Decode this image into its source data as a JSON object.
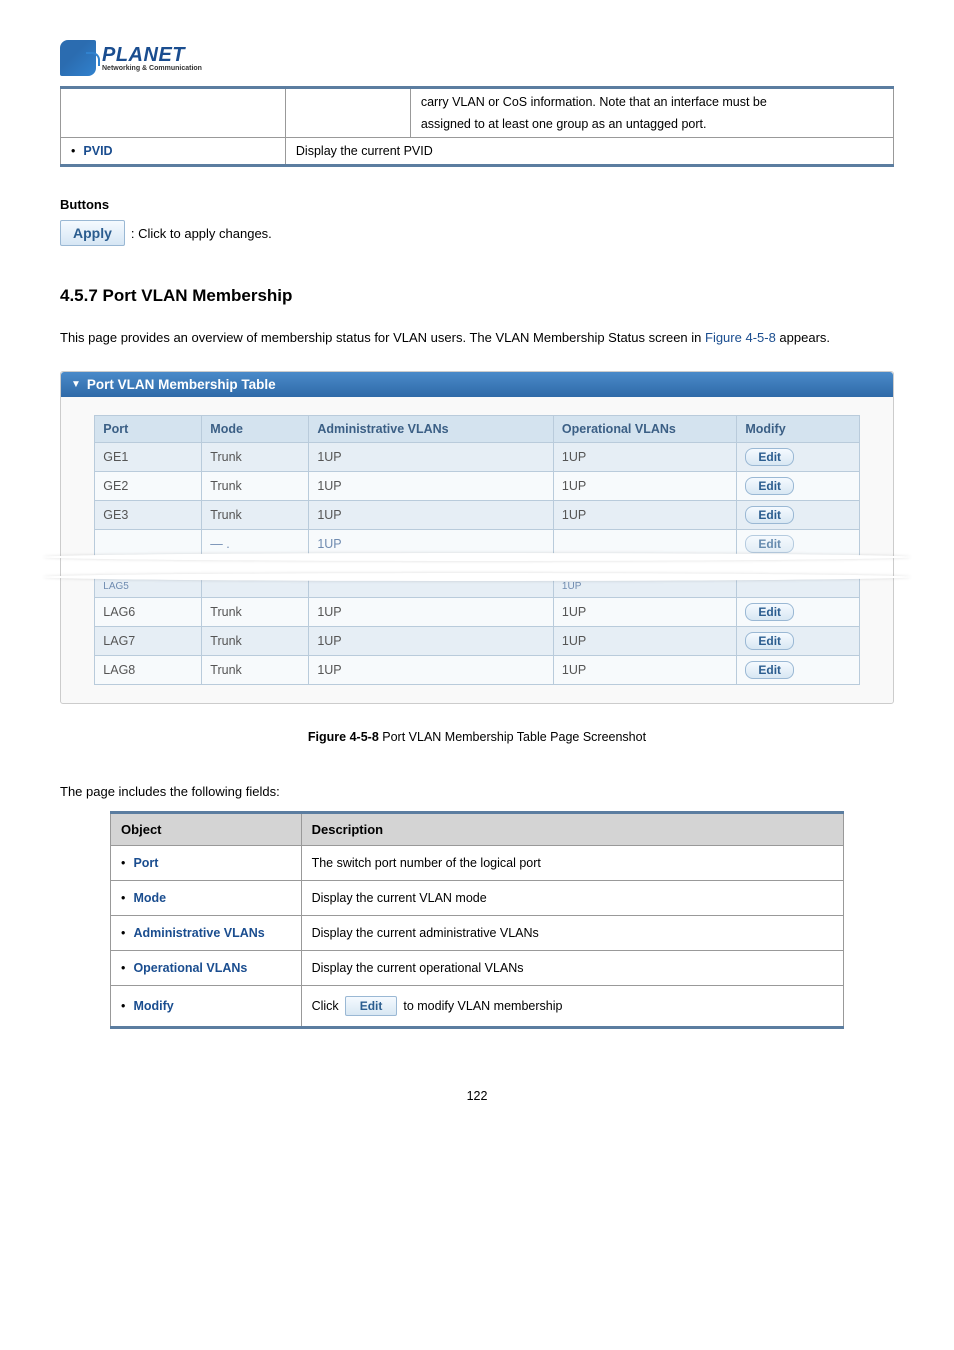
{
  "logo": {
    "word": "PLANET",
    "tag": "Networking & Communication"
  },
  "top_table": {
    "row1_desc_line1": "carry VLAN or CoS information. Note that an interface must be",
    "row1_desc_line2": "assigned to at least one group as an untagged port.",
    "row2_label": "PVID",
    "row2_desc": "Display the current PVID"
  },
  "buttons_heading": "Buttons",
  "apply_label": "Apply",
  "apply_desc": ": Click to apply changes.",
  "section_title": "4.5.7 Port VLAN Membership",
  "section_para_a": "This page provides an overview of membership status for VLAN users. The VLAN Membership Status screen in ",
  "section_para_figref": "Figure 4-5-8",
  "section_para_b": " appears.",
  "panel_title": "Port VLAN Membership Table",
  "vlan_headers": {
    "port": "Port",
    "mode": "Mode",
    "admin": "Administrative VLANs",
    "oper": "Operational VLANs",
    "modify": "Modify"
  },
  "rows_top": [
    {
      "port": "GE1",
      "mode": "Trunk",
      "admin": "1UP",
      "oper": "1UP"
    },
    {
      "port": "GE2",
      "mode": "Trunk",
      "admin": "1UP",
      "oper": "1UP"
    },
    {
      "port": "GE3",
      "mode": "Trunk",
      "admin": "1UP",
      "oper": "1UP"
    }
  ],
  "fragment_top": {
    "admin": "1UP",
    "modify": "Edit"
  },
  "fragment_bottom": {
    "port_partial": "LAG5"
  },
  "rows_bottom": [
    {
      "port": "LAG6",
      "mode": "Trunk",
      "admin": "1UP",
      "oper": "1UP"
    },
    {
      "port": "LAG7",
      "mode": "Trunk",
      "admin": "1UP",
      "oper": "1UP"
    },
    {
      "port": "LAG8",
      "mode": "Trunk",
      "admin": "1UP",
      "oper": "1UP"
    }
  ],
  "edit_label": "Edit",
  "fig_caption_bold": "Figure 4-5-8",
  "fig_caption_rest": " Port VLAN Membership Table Page Screenshot",
  "fields_intro": "The page includes the following fields:",
  "fields_headers": {
    "object": "Object",
    "description": "Description"
  },
  "fields": [
    {
      "obj": "Port",
      "desc": "The switch port number of the logical port"
    },
    {
      "obj": "Mode",
      "desc": "Display the current VLAN mode"
    },
    {
      "obj": "Administrative VLANs",
      "desc": "Display the current administrative VLANs"
    },
    {
      "obj": "Operational VLANs",
      "desc": "Display the current operational VLANs"
    }
  ],
  "modify_row": {
    "obj": "Modify",
    "pre": "Click ",
    "post": " to modify VLAN membership"
  },
  "page_number": "122"
}
